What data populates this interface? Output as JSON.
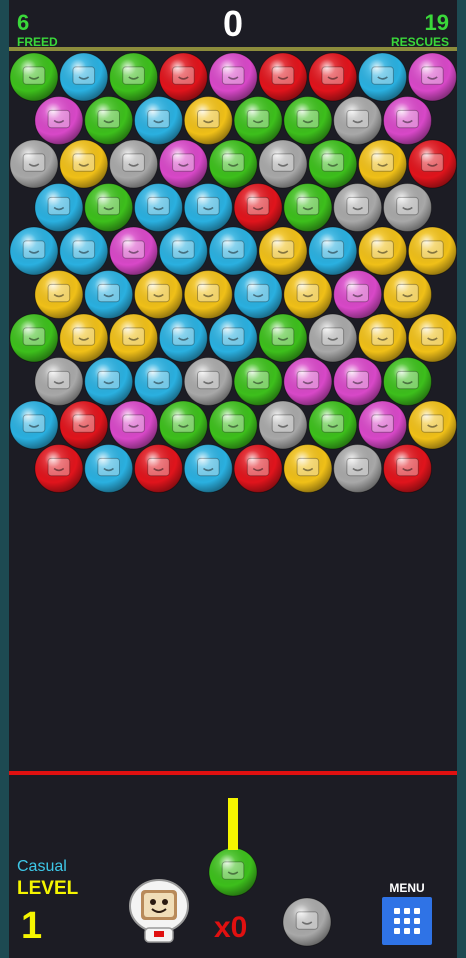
{
  "hud": {
    "freed_count": "6",
    "freed_label": "FREED",
    "score": "0",
    "rescues_count": "19",
    "rescues_label": "RESCUES"
  },
  "level": {
    "mode": "Casual",
    "label": "LEVEL",
    "number": "1"
  },
  "shooter": {
    "current_bubble": "green",
    "next_bubble": "gray",
    "multiplier": "x0"
  },
  "menu": {
    "label": "MENU",
    "icon": "grid-icon"
  },
  "colors": {
    "green": "#3dbf1c",
    "blue": "#2ab0e0",
    "red": "#e0141c",
    "pink": "#d848c8",
    "yellow": "#f0c018",
    "gray": "#a8a8a8",
    "accent_green": "#3ad83a",
    "accent_yellow": "#f5f500",
    "deadline_red": "#e01010"
  },
  "board": [
    [
      "green",
      "blue",
      "green",
      "red",
      "pink",
      "red",
      "red",
      "blue",
      "pink"
    ],
    [
      "pink",
      "green",
      "blue",
      "yellow",
      "green",
      "green",
      "gray",
      "pink"
    ],
    [
      "gray",
      "yellow",
      "gray",
      "pink",
      "green",
      "gray",
      "green",
      "yellow",
      "red"
    ],
    [
      "blue",
      "green",
      "blue",
      "blue",
      "red",
      "green",
      "gray",
      "gray"
    ],
    [
      "blue",
      "blue",
      "pink",
      "blue",
      "blue",
      "yellow",
      "blue",
      "yellow",
      "yellow"
    ],
    [
      "yellow",
      "blue",
      "yellow",
      "yellow",
      "blue",
      "yellow",
      "pink",
      "yellow"
    ],
    [
      "green",
      "yellow",
      "yellow",
      "blue",
      "blue",
      "green",
      "gray",
      "yellow",
      "yellow"
    ],
    [
      "gray",
      "blue",
      "blue",
      "gray",
      "green",
      "pink",
      "pink",
      "green"
    ],
    [
      "blue",
      "red",
      "pink",
      "green",
      "green",
      "gray",
      "green",
      "pink",
      "yellow"
    ],
    [
      "red",
      "blue",
      "red",
      "blue",
      "red",
      "yellow",
      "gray",
      "red"
    ]
  ]
}
